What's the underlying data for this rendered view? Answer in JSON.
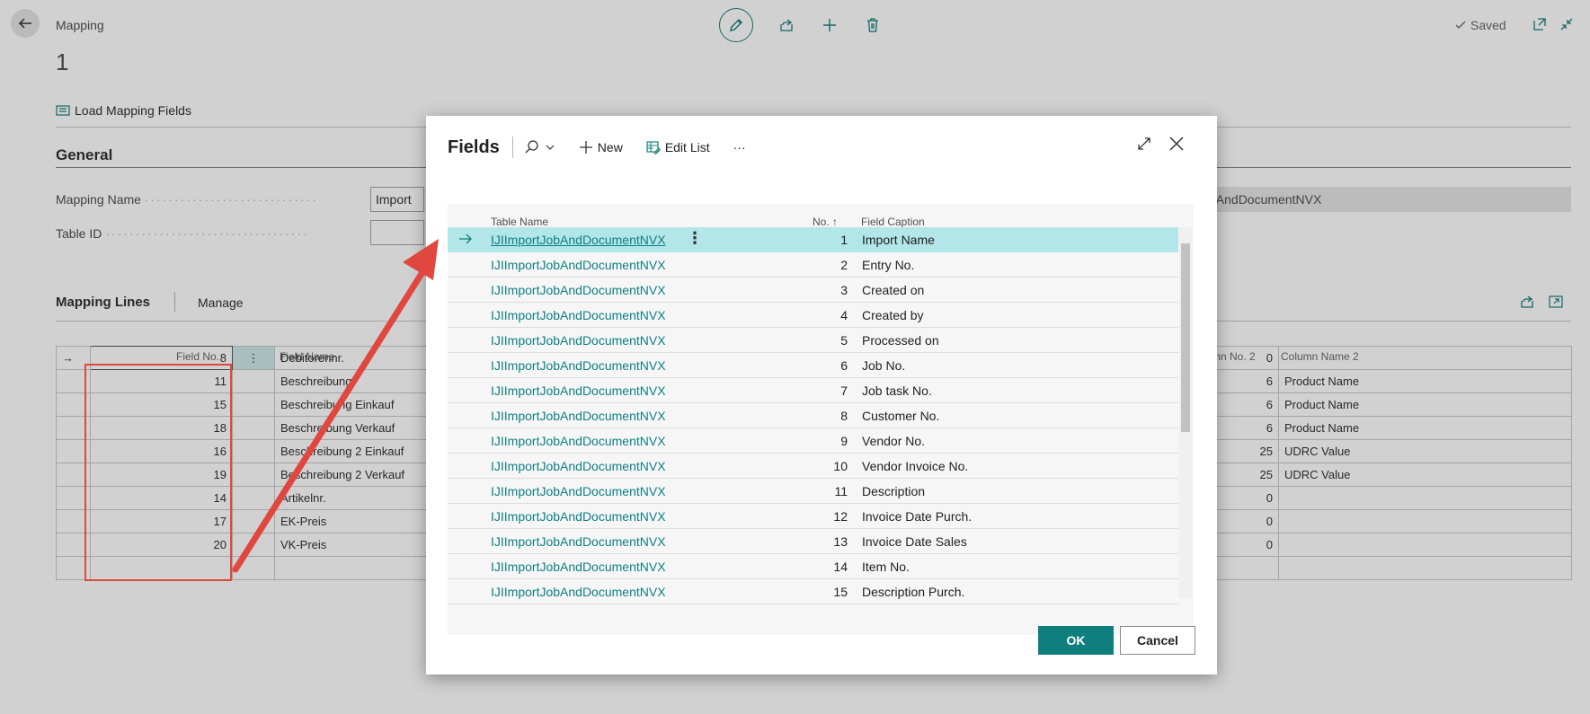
{
  "background": {
    "breadcrumb": "Mapping",
    "record_no": "1",
    "saved_label": "Saved",
    "load_button": "Load Mapping Fields",
    "section_general": "General",
    "mapping_name_label": "Mapping Name",
    "mapping_name_value": "Import",
    "table_id_label": "Table ID",
    "table_name_partial": "bAndDocumentNVX",
    "lines_title": "Mapping Lines",
    "manage_label": "Manage",
    "columns": {
      "field_no": "Field No.",
      "field_name": "Field Name",
      "column_no_2": "mn No. 2",
      "column_name_2": "Column Name 2"
    },
    "lines": [
      {
        "field_no": "8",
        "field_name": "Debitorennr.",
        "col_no_2": "0",
        "col_name_2": ""
      },
      {
        "field_no": "11",
        "field_name": "Beschreibung",
        "col_no_2": "6",
        "col_name_2": "Product Name"
      },
      {
        "field_no": "15",
        "field_name": "Beschreibung Einkauf",
        "col_no_2": "6",
        "col_name_2": "Product Name"
      },
      {
        "field_no": "18",
        "field_name": "Beschreibung Verkauf",
        "col_no_2": "6",
        "col_name_2": "Product Name"
      },
      {
        "field_no": "16",
        "field_name": "Beschreibung 2 Einkauf",
        "col_no_2": "25",
        "col_name_2": "UDRC Value"
      },
      {
        "field_no": "19",
        "field_name": "Beschreibung 2 Verkauf",
        "col_no_2": "25",
        "col_name_2": "UDRC Value"
      },
      {
        "field_no": "14",
        "field_name": "Artikelnr.",
        "col_no_2": "0",
        "col_name_2": ""
      },
      {
        "field_no": "17",
        "field_name": "EK-Preis",
        "col_no_2": "0",
        "col_name_2": ""
      },
      {
        "field_no": "20",
        "field_name": "VK-Preis",
        "col_no_2": "0",
        "col_name_2": ""
      }
    ]
  },
  "dialog": {
    "title": "Fields",
    "new_label": "New",
    "edit_list_label": "Edit List",
    "more_label": "···",
    "columns": {
      "table_name": "Table Name",
      "no": "No. ↑",
      "field_caption": "Field Caption"
    },
    "rows": [
      {
        "table_name": "IJIImportJobAndDocumentNVX",
        "no": "1",
        "caption": "Import Name"
      },
      {
        "table_name": "IJIImportJobAndDocumentNVX",
        "no": "2",
        "caption": "Entry No."
      },
      {
        "table_name": "IJIImportJobAndDocumentNVX",
        "no": "3",
        "caption": "Created on"
      },
      {
        "table_name": "IJIImportJobAndDocumentNVX",
        "no": "4",
        "caption": "Created by"
      },
      {
        "table_name": "IJIImportJobAndDocumentNVX",
        "no": "5",
        "caption": "Processed on"
      },
      {
        "table_name": "IJIImportJobAndDocumentNVX",
        "no": "6",
        "caption": "Job No."
      },
      {
        "table_name": "IJIImportJobAndDocumentNVX",
        "no": "7",
        "caption": "Job task No."
      },
      {
        "table_name": "IJIImportJobAndDocumentNVX",
        "no": "8",
        "caption": "Customer No."
      },
      {
        "table_name": "IJIImportJobAndDocumentNVX",
        "no": "9",
        "caption": "Vendor No."
      },
      {
        "table_name": "IJIImportJobAndDocumentNVX",
        "no": "10",
        "caption": "Vendor Invoice No."
      },
      {
        "table_name": "IJIImportJobAndDocumentNVX",
        "no": "11",
        "caption": "Description"
      },
      {
        "table_name": "IJIImportJobAndDocumentNVX",
        "no": "12",
        "caption": "Invoice Date Purch."
      },
      {
        "table_name": "IJIImportJobAndDocumentNVX",
        "no": "13",
        "caption": "Invoice Date Sales"
      },
      {
        "table_name": "IJIImportJobAndDocumentNVX",
        "no": "14",
        "caption": "Item No."
      },
      {
        "table_name": "IJIImportJobAndDocumentNVX",
        "no": "15",
        "caption": "Description Purch."
      }
    ],
    "ok_label": "OK",
    "cancel_label": "Cancel"
  },
  "colors": {
    "accent": "#0e7f7d",
    "link": "#0d7f83",
    "selected_row": "#b3e6e9",
    "annotation": "#e0473f"
  }
}
